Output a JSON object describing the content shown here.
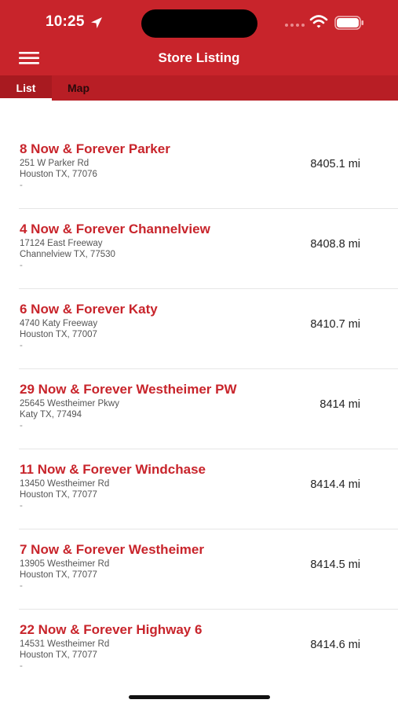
{
  "status_bar": {
    "time": "10:25",
    "icons": [
      "location-arrow-icon",
      "cellular-signal-icon",
      "wifi-icon",
      "battery-icon"
    ]
  },
  "header": {
    "title": "Store Listing",
    "menu_icon": "hamburger-menu-icon",
    "color": "#c8242b"
  },
  "tabs": [
    {
      "label": "List",
      "selected": true
    },
    {
      "label": "Map",
      "selected": false
    }
  ],
  "stores": [
    {
      "name": "8 Now & Forever Parker",
      "address1": "251 W Parker Rd",
      "address2": "Houston TX, 77076",
      "address3": "-",
      "distance": "8405.1 mi"
    },
    {
      "name": "4 Now & Forever Channelview",
      "address1": "17124 East Freeway",
      "address2": "Channelview TX, 77530",
      "address3": "-",
      "distance": "8408.8 mi"
    },
    {
      "name": "6 Now & Forever Katy",
      "address1": "4740 Katy Freeway",
      "address2": "Houston TX, 77007",
      "address3": "-",
      "distance": "8410.7 mi"
    },
    {
      "name": "29 Now & Forever Westheimer PW",
      "address1": "25645 Westheimer Pkwy",
      "address2": "Katy TX, 77494",
      "address3": "-",
      "distance": "8414 mi"
    },
    {
      "name": "11 Now & Forever Windchase",
      "address1": "13450 Westheimer Rd",
      "address2": "Houston TX, 77077",
      "address3": "-",
      "distance": "8414.4 mi"
    },
    {
      "name": "7 Now & Forever Westheimer",
      "address1": "13905 Westheimer Rd",
      "address2": "Houston TX, 77077",
      "address3": "-",
      "distance": "8414.5 mi"
    },
    {
      "name": "22 Now & Forever Highway 6",
      "address1": "14531 Westheimer Rd",
      "address2": "Houston TX, 77077",
      "address3": "-",
      "distance": "8414.6 mi"
    }
  ]
}
